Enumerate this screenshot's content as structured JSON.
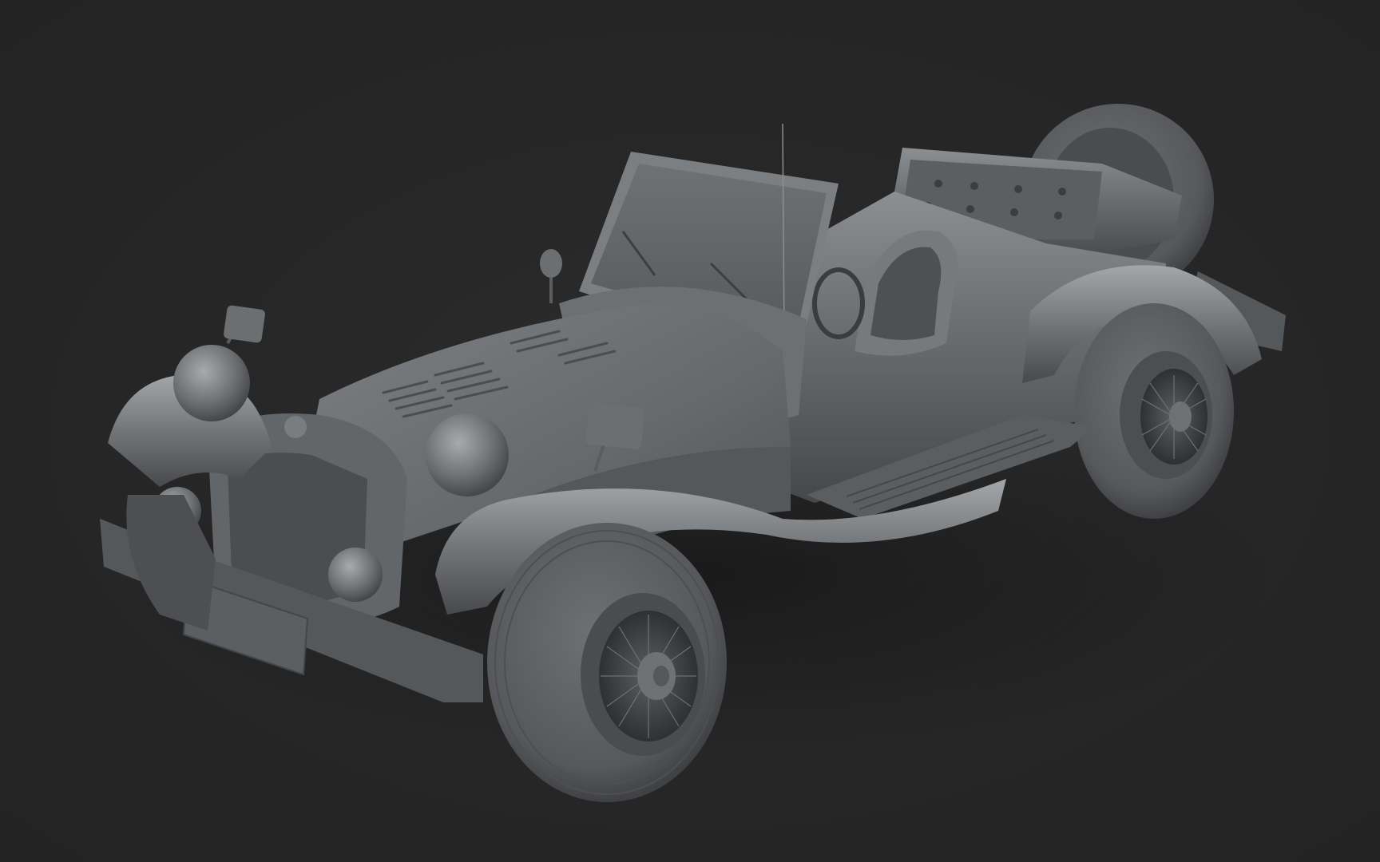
{
  "scene": {
    "subject": "vintage-roadster-clay-render",
    "colors": {
      "background": "#262626",
      "body": "#6b6e71",
      "body_light": "#9a9da0",
      "body_dark": "#3d3f42",
      "tire": "#5a5c5f",
      "shadow": "#1c1c1c"
    }
  }
}
